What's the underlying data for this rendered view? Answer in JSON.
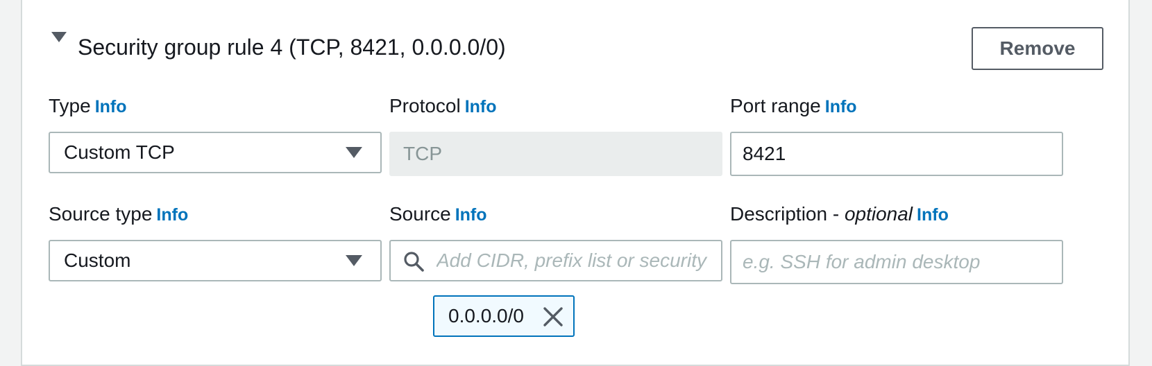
{
  "rule": {
    "title": "Security group rule 4 (TCP, 8421, 0.0.0.0/0)",
    "remove_label": "Remove"
  },
  "info_label": "Info",
  "fields": {
    "type": {
      "label": "Type",
      "value": "Custom TCP"
    },
    "protocol": {
      "label": "Protocol",
      "value": "TCP"
    },
    "port_range": {
      "label": "Port range",
      "value": "8421"
    },
    "source_type": {
      "label": "Source type",
      "value": "Custom"
    },
    "source": {
      "label": "Source",
      "placeholder": "Add CIDR, prefix list or security group",
      "tokens": [
        "0.0.0.0/0"
      ]
    },
    "description": {
      "label": "Description - ",
      "label_optional": "optional",
      "placeholder": "e.g. SSH for admin desktop"
    }
  },
  "icons": {
    "expand": "caret-down-icon",
    "select": "chevron-down-icon",
    "search": "search-icon",
    "dismiss": "close-icon"
  },
  "colors": {
    "link": "#0073bb",
    "border": "#aab7b8",
    "disabled_bg": "#eaeded",
    "token_bg": "#f1faff"
  }
}
